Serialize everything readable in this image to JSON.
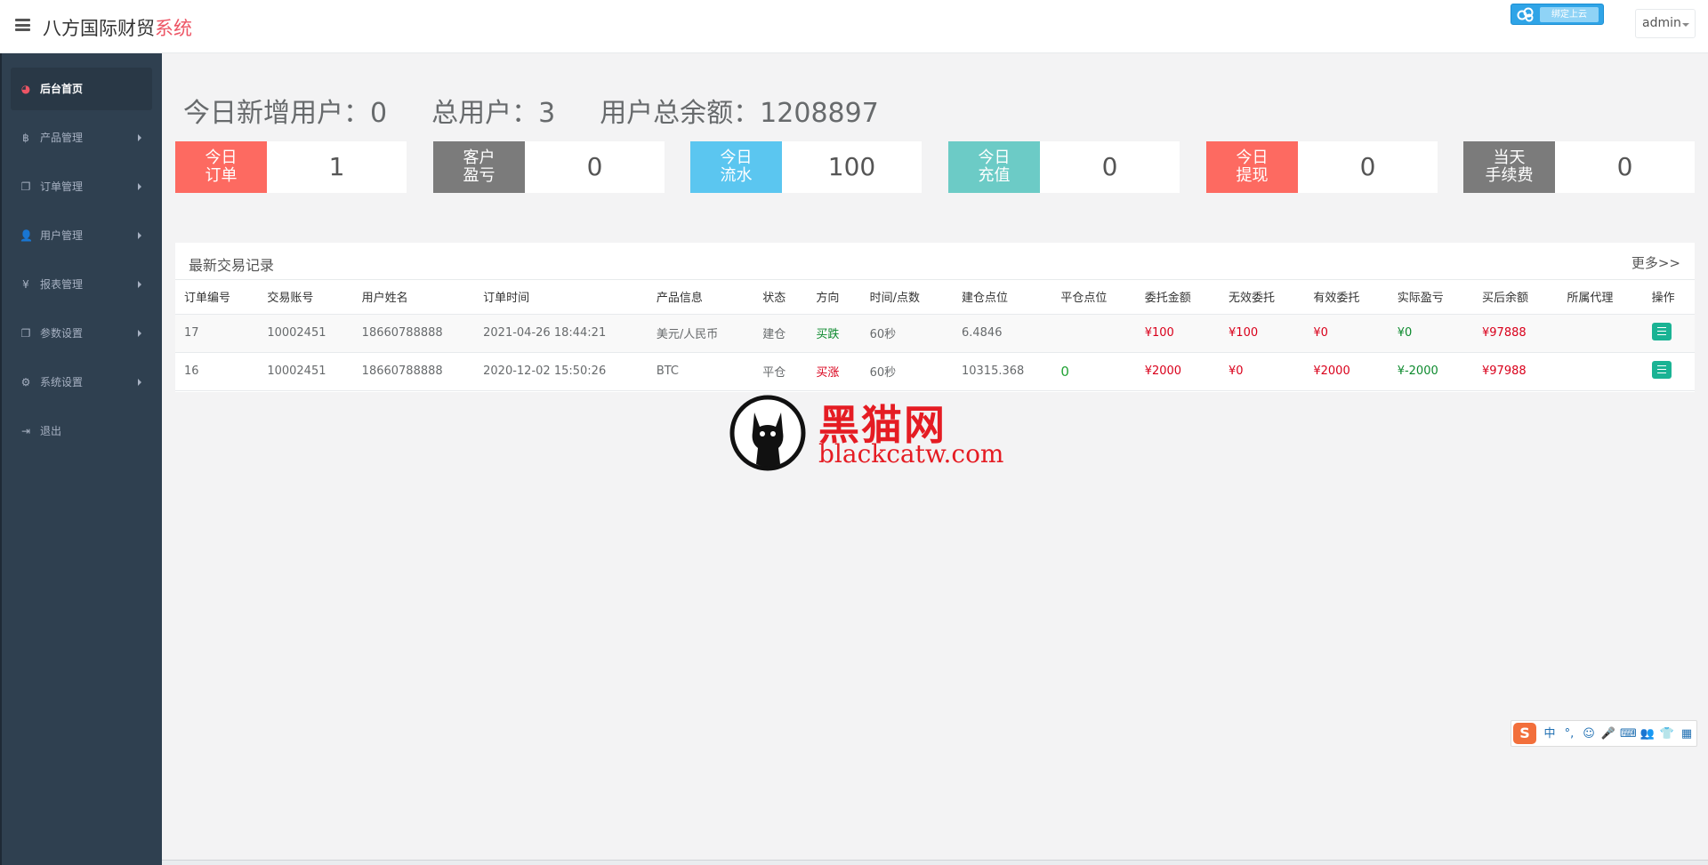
{
  "app": {
    "title_main": "八方国际财贸",
    "title_accent": "系统",
    "cloud_button_label": "绑定上云"
  },
  "header": {
    "user_menu_label": "admin"
  },
  "sidebar": {
    "items": [
      {
        "label": "后台首页",
        "icon": "dashboard-icon",
        "active": true
      },
      {
        "label": "产品管理",
        "icon": "bitcoin-icon"
      },
      {
        "label": "订单管理",
        "icon": "copy-icon"
      },
      {
        "label": "用户管理",
        "icon": "user-icon"
      },
      {
        "label": "报表管理",
        "icon": "yen-icon"
      },
      {
        "label": "参数设置",
        "icon": "copy-icon"
      },
      {
        "label": "系统设置",
        "icon": "gears-icon"
      },
      {
        "label": "退出",
        "icon": "sign-out-icon"
      }
    ]
  },
  "summary": {
    "new_users": "今日新增用户：0",
    "total_users": "总用户：3",
    "total_balance": "用户总余额：1208897"
  },
  "stats": [
    {
      "label_line1": "今日",
      "label_line2": "订单",
      "value": "1",
      "color": "#fd6a61"
    },
    {
      "label_line1": "客户",
      "label_line2": "盈亏",
      "value": "0",
      "color": "#7b7b7b"
    },
    {
      "label_line1": "今日",
      "label_line2": "流水",
      "value": "100",
      "color": "#5bc6f0"
    },
    {
      "label_line1": "今日",
      "label_line2": "充值",
      "value": "0",
      "color": "#6ccbc6"
    },
    {
      "label_line1": "今日",
      "label_line2": "提现",
      "value": "0",
      "color": "#fd6a61"
    },
    {
      "label_line1": "当天",
      "label_line2": "手续费",
      "value": "0",
      "color": "#7b7b7b"
    }
  ],
  "trades": {
    "title": "最新交易记录",
    "more": "更多>>",
    "headers": [
      "订单编号",
      "交易账号",
      "用户姓名",
      "订单时间",
      "产品信息",
      "状态",
      "方向",
      "时间/点数",
      "建仓点位",
      "平仓点位",
      "委托金额",
      "无效委托",
      "有效委托",
      "实际盈亏",
      "买后余额",
      "所属代理",
      "操作"
    ],
    "rows": [
      {
        "order_id": "17",
        "account": "10002451",
        "user_name": "18660788888",
        "time": "2021-04-26 18:44:21",
        "product": "美元/人民币",
        "status": "建仓",
        "direction": "买跌",
        "duration": "60秒",
        "open_price": "6.4846",
        "close_price": "",
        "amount": "¥100",
        "invalid": "¥100",
        "valid": "¥0",
        "profit": "¥0",
        "balance": "¥97888",
        "agent": ""
      },
      {
        "order_id": "16",
        "account": "10002451",
        "user_name": "18660788888",
        "time": "2020-12-02 15:50:26",
        "product": "BTC",
        "status": "平仓",
        "direction": "买涨",
        "duration": "60秒",
        "open_price": "10315.368",
        "close_price": "0",
        "amount": "¥2000",
        "invalid": "¥0",
        "valid": "¥2000",
        "profit": "¥-2000",
        "balance": "¥97988",
        "agent": ""
      }
    ]
  },
  "watermark": {
    "text_cn": "黑猫网",
    "text_en": "blackcatw.com"
  },
  "ime_toolbar": {
    "logo": "S",
    "items": [
      "中",
      "°,",
      "☺",
      "🎤",
      "⌨",
      "👥",
      "👕",
      "▦"
    ]
  }
}
